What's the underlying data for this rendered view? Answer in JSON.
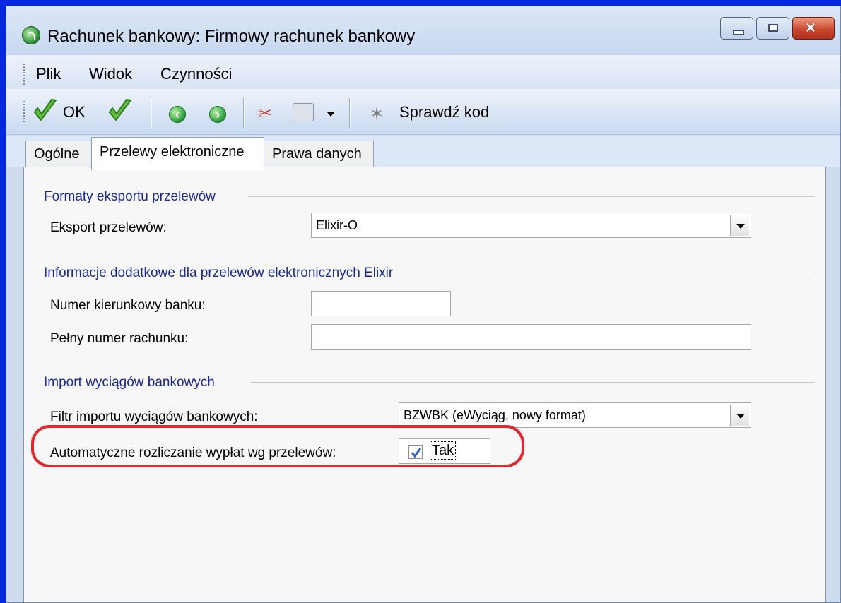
{
  "window": {
    "title": "Rachunek bankowy: Firmowy rachunek bankowy",
    "controls": {
      "minimize": "minimize-icon",
      "maximize": "maximize-icon",
      "close": "close-icon"
    }
  },
  "menu": {
    "items": [
      "Plik",
      "Widok",
      "Czynności"
    ]
  },
  "toolbar": {
    "ok_label": "OK",
    "check_code_label": "Sprawdź kod",
    "icons": [
      "ok-check-icon",
      "ok-next-check-icon",
      "previous-arrow-icon",
      "next-arrow-icon",
      "tools-icon",
      "printer-icon",
      "dropdown-arrow-icon",
      "sparkle-check-icon"
    ]
  },
  "tabs": [
    {
      "label": "Ogólne",
      "active": false
    },
    {
      "label": "Przelewy elektroniczne",
      "active": true
    },
    {
      "label": "Prawa danych",
      "active": false
    }
  ],
  "sections": {
    "export": {
      "title": "Formaty eksportu przelewów",
      "export_label": "Eksport przelewów:",
      "export_value": "Elixir-O"
    },
    "elixir": {
      "title": "Informacje dodatkowe dla przelewów elektronicznych Elixir",
      "bank_code_label": "Numer kierunkowy banku:",
      "bank_code_value": "",
      "account_label": "Pełny numer rachunku:",
      "account_value": ""
    },
    "import": {
      "title": "Import wyciągów bankowych",
      "filter_label": "Filtr importu wyciągów bankowych:",
      "filter_value": "BZWBK (eWyciąg, nowy format)",
      "auto_label": "Automatyczne rozliczanie wypłat wg przelewów:",
      "auto_value": "Tak",
      "auto_checked": true
    }
  },
  "highlight": {
    "color": "#e0282d"
  }
}
